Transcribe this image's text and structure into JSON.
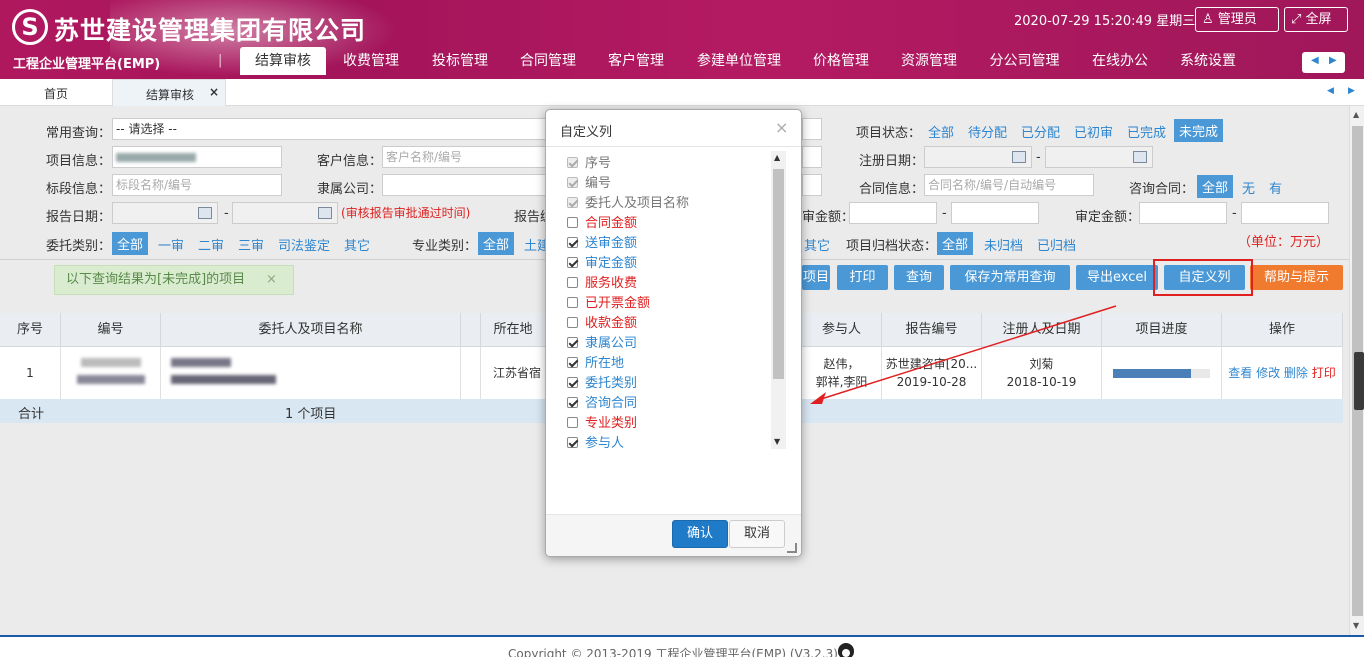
{
  "header": {
    "company": "苏世建设管理集团有限公司",
    "platform": "工程企业管理平台(EMP)",
    "datetime": "2020-07-29 15:20:49 星期三",
    "admin_label": "管理员",
    "fullscreen_label": "全屏",
    "brand_color": "#a3145a"
  },
  "nav": {
    "items": [
      "结算审核",
      "收费管理",
      "投标管理",
      "合同管理",
      "客户管理",
      "参建单位管理",
      "价格管理",
      "资源管理",
      "分公司管理",
      "在线办公",
      "系统设置"
    ],
    "active": "结算审核"
  },
  "tabs": {
    "home": "首页",
    "current": "结算审核"
  },
  "filters": {
    "common_query_label": "常用查询：",
    "common_query_value": "-- 请选择 --",
    "project_info_label": "项目信息：",
    "client_info_label": "客户信息：",
    "client_info_placeholder": "客户名称/编号",
    "section_info_label": "标段信息：",
    "section_info_placeholder": "标段名称/编号",
    "affiliated_company_label": "隶属公司：",
    "report_date_label": "报告日期：",
    "report_date_hint": "(审核报告审批通过时间)",
    "report_label_partial": "报告编",
    "delegate_type_label": "委托类别：",
    "delegate_types": [
      "全部",
      "一审",
      "二审",
      "三审",
      "司法鉴定",
      "其它"
    ],
    "specialty_label": "专业类别：",
    "specialty_all": "全部",
    "specialty_partial": "土建",
    "project_status_label": "项目状态：",
    "project_statuses": [
      "全部",
      "待分配",
      "已分配",
      "已初审",
      "已完成",
      "未完成"
    ],
    "register_date_label": "注册日期：",
    "contract_info_label": "合同信息：",
    "contract_info_placeholder": "合同名称/编号/自动编号",
    "consult_contract_label": "咨询合同：",
    "consult_contract_options": [
      "全部",
      "无",
      "有"
    ],
    "audit_amount_label_partial": "审金额：",
    "approved_amount_label": "审定金额：",
    "other_partial": "其它",
    "archive_label": "项目归档状态：",
    "archive_options": [
      "全部",
      "未归档",
      "已归档"
    ],
    "unit_note": "（单位：万元）",
    "dash": "-"
  },
  "notice": {
    "text": "以下查询结果为[未完成]的项目",
    "close": "×"
  },
  "actions": {
    "partial_btn": "项目",
    "print": "打印",
    "query": "查询",
    "save_query": "保存为常用查询",
    "export": "导出excel",
    "custom_columns": "自定义列",
    "help": "帮助与提示"
  },
  "table": {
    "headers": [
      "序号",
      "编号",
      "委托人及项目名称",
      "所在地",
      "参与人",
      "报告编号",
      "注册人及日期",
      "项目进度",
      "操作"
    ],
    "row": {
      "index": "1",
      "location": "江苏省宿",
      "participants_line1": "赵伟，",
      "participants_line2": "郭祥,李阳",
      "report_no": "苏世建咨审[20...",
      "report_date": "2019-10-28",
      "registrant": "刘菊",
      "register_date": "2018-10-19",
      "progress": 0.8,
      "ops": [
        "查看",
        "修改",
        "删除",
        "打印"
      ]
    },
    "sum_label": "合计",
    "sum_count": "1 个项目"
  },
  "dialog": {
    "title": "自定义列",
    "close": "×",
    "items": [
      {
        "label": "序号",
        "checked": true,
        "disabled": true,
        "color": "gray"
      },
      {
        "label": "编号",
        "checked": true,
        "disabled": true,
        "color": "gray"
      },
      {
        "label": "委托人及项目名称",
        "checked": true,
        "disabled": true,
        "color": "gray"
      },
      {
        "label": "合同金额",
        "checked": false,
        "disabled": false,
        "color": "red"
      },
      {
        "label": "送审金额",
        "checked": true,
        "disabled": false,
        "color": "blue"
      },
      {
        "label": "审定金额",
        "checked": true,
        "disabled": false,
        "color": "blue"
      },
      {
        "label": "服务收费",
        "checked": false,
        "disabled": false,
        "color": "red"
      },
      {
        "label": "已开票金额",
        "checked": false,
        "disabled": false,
        "color": "red"
      },
      {
        "label": "收款金额",
        "checked": false,
        "disabled": false,
        "color": "red"
      },
      {
        "label": "隶属公司",
        "checked": true,
        "disabled": false,
        "color": "blue"
      },
      {
        "label": "所在地",
        "checked": true,
        "disabled": false,
        "color": "blue"
      },
      {
        "label": "委托类别",
        "checked": true,
        "disabled": false,
        "color": "blue"
      },
      {
        "label": "咨询合同",
        "checked": true,
        "disabled": false,
        "color": "blue"
      },
      {
        "label": "专业类别",
        "checked": false,
        "disabled": false,
        "color": "red"
      },
      {
        "label": "参与人",
        "checked": true,
        "disabled": false,
        "color": "blue"
      }
    ],
    "confirm": "确认",
    "cancel": "取消"
  },
  "footer": {
    "copyright": "Copyright © 2013-2019 工程企业管理平台(EMP) (V3.2.3)"
  }
}
